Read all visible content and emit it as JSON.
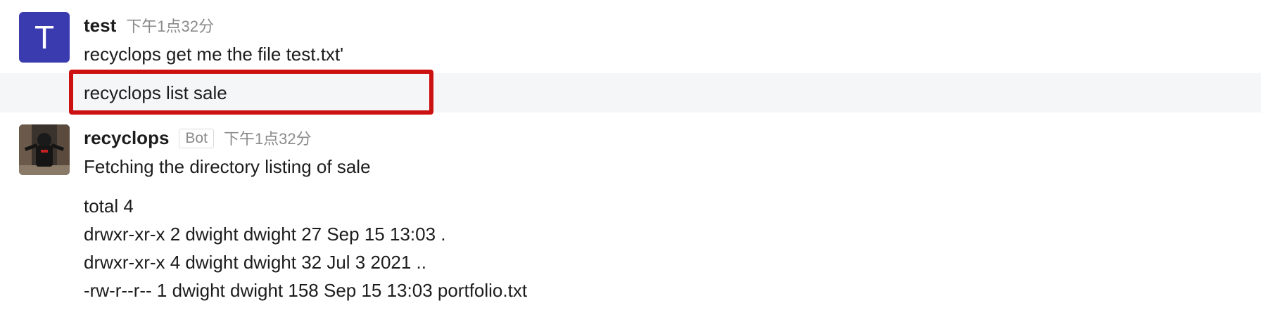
{
  "messages": [
    {
      "avatar_letter": "T",
      "sender": "test",
      "timestamp": "下午1点32分",
      "lines": [
        "recyclops get me the file test.txt'",
        "recyclops list sale"
      ]
    },
    {
      "sender": "recyclops",
      "badge": "Bot",
      "timestamp": "下午1点32分",
      "intro": "Fetching the directory listing of sale",
      "listing": [
        "total 4",
        "drwxr-xr-x 2 dwight dwight 27 Sep 15 13:03 .",
        "drwxr-xr-x 4 dwight dwight 32 Jul 3 2021 ..",
        "-rw-r--r-- 1 dwight dwight 158 Sep 15 13:03 portfolio.txt"
      ]
    }
  ],
  "colors": {
    "avatar_bg": "#3b3bb0",
    "highlight_border": "#cc1111",
    "hover_bg": "#f5f6f8"
  },
  "icons": {
    "user_avatar": "letter-avatar",
    "bot_avatar": "photo-avatar"
  }
}
